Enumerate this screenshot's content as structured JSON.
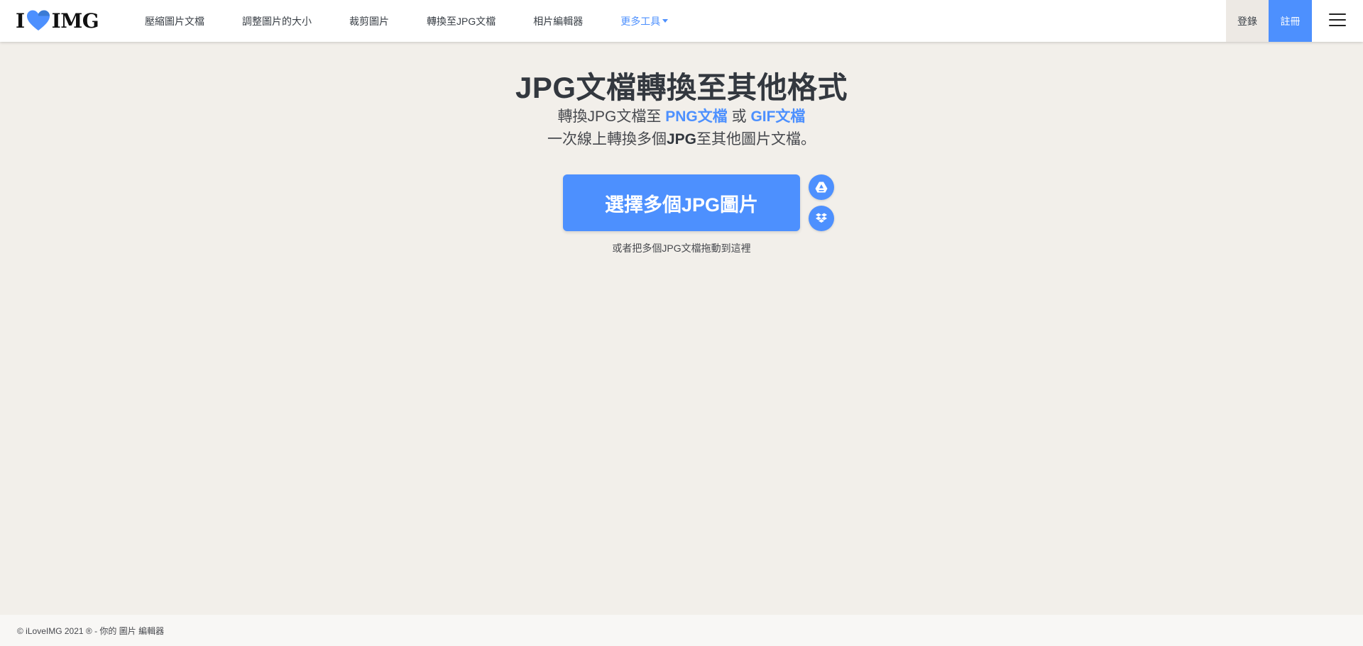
{
  "header": {
    "logo_left": "I",
    "logo_right": "IMG",
    "nav": [
      {
        "label": "壓縮圖片文檔"
      },
      {
        "label": "調整圖片的大小"
      },
      {
        "label": "裁剪圖片"
      },
      {
        "label": "轉換至JPG文檔"
      },
      {
        "label": "相片編輯器"
      },
      {
        "label": "更多工具"
      }
    ],
    "login_label": "登錄",
    "signup_label": "註冊",
    "menu_icon": "hamburger-menu-icon"
  },
  "hero": {
    "title": "JPG文檔轉換至其他格式",
    "subtitle_prefix": "轉換JPG文檔至",
    "subtitle_link1": "PNG文檔",
    "subtitle_or": "或",
    "subtitle_link2": "GIF文檔",
    "subtitle2_prefix": "一次線上轉換多個",
    "subtitle2_bold": "JPG",
    "subtitle2_suffix": "至其他圖片文檔。",
    "select_button": "選擇多個JPG圖片",
    "drop_hint": "或者把多個JPG文檔拖動到這裡",
    "cloud_icons": [
      "google-drive-icon",
      "dropbox-icon"
    ]
  },
  "footer": {
    "text": "© iLoveIMG 2021 ® - 你的 圖片 編輯器"
  },
  "colors": {
    "accent": "#4d90fe",
    "background": "#f2efea",
    "header": "#ffffff",
    "text": "#383e45"
  }
}
